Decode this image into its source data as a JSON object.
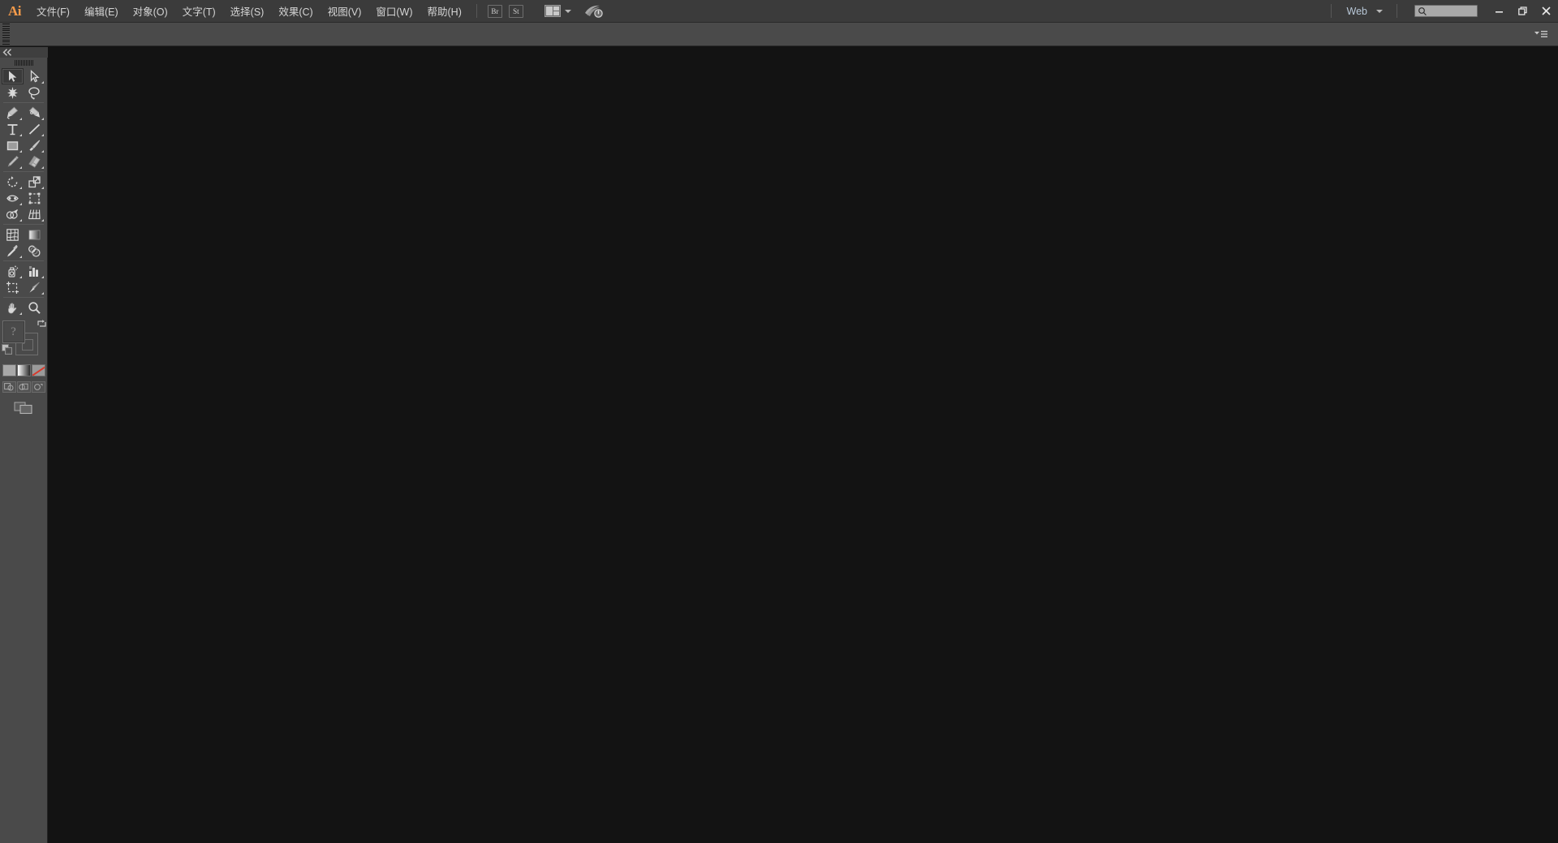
{
  "app": {
    "name": "Adobe Illustrator",
    "logo_text": "Ai"
  },
  "menubar": {
    "items": [
      {
        "label": "文件(F)",
        "name": "menu-file"
      },
      {
        "label": "编辑(E)",
        "name": "menu-edit"
      },
      {
        "label": "对象(O)",
        "name": "menu-object"
      },
      {
        "label": "文字(T)",
        "name": "menu-type"
      },
      {
        "label": "选择(S)",
        "name": "menu-select"
      },
      {
        "label": "效果(C)",
        "name": "menu-effect"
      },
      {
        "label": "视图(V)",
        "name": "menu-view"
      },
      {
        "label": "窗口(W)",
        "name": "menu-window"
      },
      {
        "label": "帮助(H)",
        "name": "menu-help"
      }
    ],
    "bridge_button": "Br",
    "stock_button": "St",
    "arrange_documents_tooltip": "排列文档",
    "cc_libraries_tooltip": "Adobe Creative Cloud"
  },
  "workspace": {
    "current": "Web",
    "search_placeholder": ""
  },
  "window_controls": {
    "minimize": "—",
    "restore": "❐",
    "close": "✕"
  },
  "toolbar": {
    "collapse_tooltip": "折叠",
    "tools": [
      {
        "label": "选择工具",
        "name": "tool-selection",
        "icon": "selection-icon",
        "active": true,
        "corner": false
      },
      {
        "label": "直接选择工具",
        "name": "tool-direct-selection",
        "icon": "direct-selection-icon",
        "active": false,
        "corner": true
      },
      {
        "label": "魔棒工具",
        "name": "tool-magic-wand",
        "icon": "magic-wand-icon",
        "active": false,
        "corner": false
      },
      {
        "label": "套索工具",
        "name": "tool-lasso",
        "icon": "lasso-icon",
        "active": false,
        "corner": false
      },
      {
        "label": "钢笔工具",
        "name": "tool-pen",
        "icon": "pen-icon",
        "active": false,
        "corner": true
      },
      {
        "label": "曲率工具",
        "name": "tool-curvature",
        "icon": "curvature-pen-icon",
        "active": false,
        "corner": true
      },
      {
        "label": "文字工具",
        "name": "tool-type",
        "icon": "type-icon",
        "active": false,
        "corner": true
      },
      {
        "label": "直线段工具",
        "name": "tool-line-segment",
        "icon": "line-segment-icon",
        "active": false,
        "corner": true
      },
      {
        "label": "矩形工具",
        "name": "tool-rectangle",
        "icon": "rectangle-icon",
        "active": false,
        "corner": true
      },
      {
        "label": "画笔工具",
        "name": "tool-paintbrush",
        "icon": "paintbrush-icon",
        "active": false,
        "corner": true
      },
      {
        "label": "铅笔工具",
        "name": "tool-pencil",
        "icon": "pencil-icon",
        "active": false,
        "corner": true
      },
      {
        "label": "橡皮擦工具",
        "name": "tool-eraser",
        "icon": "eraser-icon",
        "active": false,
        "corner": true
      },
      {
        "label": "旋转工具",
        "name": "tool-rotate",
        "icon": "rotate-icon",
        "active": false,
        "corner": true
      },
      {
        "label": "比例缩放工具",
        "name": "tool-scale",
        "icon": "scale-icon",
        "active": false,
        "corner": true
      },
      {
        "label": "宽度工具",
        "name": "tool-width",
        "icon": "width-icon",
        "active": false,
        "corner": true
      },
      {
        "label": "自由变换工具",
        "name": "tool-free-transform",
        "icon": "free-transform-icon",
        "active": false,
        "corner": false
      },
      {
        "label": "形状生成器工具",
        "name": "tool-shape-builder",
        "icon": "shape-builder-icon",
        "active": false,
        "corner": true
      },
      {
        "label": "透视网格工具",
        "name": "tool-perspective-grid",
        "icon": "perspective-grid-icon",
        "active": false,
        "corner": true
      },
      {
        "label": "网格工具",
        "name": "tool-mesh",
        "icon": "mesh-icon",
        "active": false,
        "corner": false
      },
      {
        "label": "渐变工具",
        "name": "tool-gradient",
        "icon": "gradient-icon",
        "active": false,
        "corner": false
      },
      {
        "label": "吸管工具",
        "name": "tool-eyedropper",
        "icon": "eyedropper-icon",
        "active": false,
        "corner": true
      },
      {
        "label": "混合工具",
        "name": "tool-blend",
        "icon": "blend-icon",
        "active": false,
        "corner": false
      },
      {
        "label": "符号喷枪工具",
        "name": "tool-symbol-sprayer",
        "icon": "symbol-sprayer-icon",
        "active": false,
        "corner": true
      },
      {
        "label": "柱形图工具",
        "name": "tool-column-graph",
        "icon": "column-graph-icon",
        "active": false,
        "corner": true
      },
      {
        "label": "画板工具",
        "name": "tool-artboard",
        "icon": "artboard-icon",
        "active": false,
        "corner": false
      },
      {
        "label": "切片工具",
        "name": "tool-slice",
        "icon": "slice-icon",
        "active": false,
        "corner": true
      },
      {
        "label": "抓手工具",
        "name": "tool-hand",
        "icon": "hand-icon",
        "active": false,
        "corner": true
      },
      {
        "label": "缩放工具",
        "name": "tool-zoom",
        "icon": "zoom-icon",
        "active": false,
        "corner": false
      }
    ],
    "divider_after_indices": [
      3,
      11,
      17,
      21,
      25
    ],
    "fill_stroke": {
      "fill_label": "?",
      "stroke_label": "?",
      "swap_tooltip": "互换填色和描边",
      "default_tooltip": "默认填色和描边"
    },
    "color_modes": [
      {
        "label": "颜色",
        "name": "color-mode-color"
      },
      {
        "label": "渐变",
        "name": "color-mode-gradient"
      },
      {
        "label": "无",
        "name": "color-mode-none"
      }
    ],
    "draw_modes": [
      {
        "label": "正常绘图",
        "name": "draw-mode-normal"
      },
      {
        "label": "背面绘图",
        "name": "draw-mode-behind"
      },
      {
        "label": "内部绘图",
        "name": "draw-mode-inside"
      }
    ],
    "screen_mode": {
      "label": "更改屏幕模式",
      "name": "screen-mode-button"
    }
  },
  "colors": {
    "menubar_bg": "#3b3b3b",
    "controlbar_bg": "#4a4a4a",
    "toolbar_bg": "#4a4a4a",
    "canvas_bg": "#131313",
    "accent_orange": "#f59b4a",
    "text": "#d4d4d4",
    "workspace_text": "#b9c8d8"
  },
  "canvas": {
    "document_open": false,
    "background": "#131313"
  }
}
